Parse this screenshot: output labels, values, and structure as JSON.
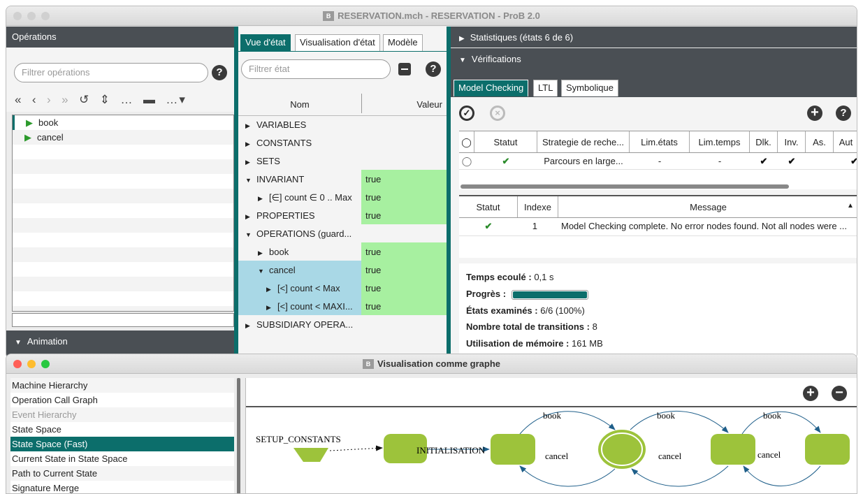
{
  "main_window": {
    "title": "RESERVATION.mch - RESERVATION - ProB 2.0"
  },
  "operations": {
    "header": "Opérations",
    "filter_placeholder": "Filtrer opérations",
    "toolbar": [
      "«",
      "‹",
      "›",
      "»",
      "↺",
      "⇕",
      "…",
      "…"
    ],
    "items": [
      "book",
      "cancel"
    ],
    "animation_label": "Animation"
  },
  "state_view": {
    "tabs": [
      "Vue d'état",
      "Visualisation d'état",
      "Modèle"
    ],
    "filter_placeholder": "Filtrer état",
    "col_name": "Nom",
    "col_value": "Valeur",
    "rows": [
      {
        "name": "VARIABLES",
        "value": "",
        "tri": "▶"
      },
      {
        "name": "CONSTANTS",
        "value": "",
        "tri": "▶"
      },
      {
        "name": "SETS",
        "value": "",
        "tri": "▶"
      },
      {
        "name": "INVARIANT",
        "value": "true",
        "tri": "▼"
      },
      {
        "name": "[∈] count ∈ 0 .. Max",
        "value": "true",
        "tri": "▶"
      },
      {
        "name": "PROPERTIES",
        "value": "true",
        "tri": "▶"
      },
      {
        "name": "OPERATIONS (guard...",
        "value": "",
        "tri": "▼"
      },
      {
        "name": "book",
        "value": "true",
        "tri": "▶"
      },
      {
        "name": "cancel",
        "value": "true",
        "tri": "▼"
      },
      {
        "name": "[<] count < Max",
        "value": "true",
        "tri": "▶"
      },
      {
        "name": "[<] count < MAXI...",
        "value": "true",
        "tri": "▶"
      },
      {
        "name": "SUBSIDIARY OPERA...",
        "value": "",
        "tri": "▶"
      }
    ]
  },
  "right_panel": {
    "stats_header": "Statistiques (états 6 de 6)",
    "verif_header": "Vérifications",
    "tabs": [
      "Model Checking",
      "LTL",
      "Symbolique"
    ],
    "table1_headers": [
      "Statut",
      "Strategie de reche...",
      "Lim.états",
      "Lim.temps",
      "Dlk.",
      "Inv.",
      "As.",
      "Aut"
    ],
    "table1_row": {
      "strategy": "Parcours en large...",
      "lim_states": "-",
      "lim_time": "-"
    },
    "table2_headers": [
      "Statut",
      "Indexe",
      "Message"
    ],
    "table2_row": {
      "index": "1",
      "message": "Model Checking complete. No error nodes found. Not all nodes were ..."
    },
    "stats": [
      {
        "label": "Temps ecoulé :",
        "value": "0,1 s"
      },
      {
        "label": "Progrès :",
        "value": ""
      },
      {
        "label": "États examinés :",
        "value": "6/6 (100%)"
      },
      {
        "label": "Nombre total de transitions :",
        "value": "8"
      },
      {
        "label": "Utilisation de mémoire :",
        "value": "161 MB"
      }
    ],
    "progress": 1.0
  },
  "graph_window": {
    "title": "Visualisation comme graphe",
    "list": [
      "Machine Hierarchy",
      "Operation Call Graph",
      "Event Hierarchy",
      "State Space",
      "State Space (Fast)",
      "Current State in State Space",
      "Path to Current State",
      "Signature Merge"
    ],
    "selected": "State Space (Fast)",
    "graph_labels": {
      "setup": "SETUP_CONSTANTS",
      "init": "INITIALISATION",
      "book": "book",
      "cancel": "cancel"
    }
  },
  "colors": {
    "accent": "#0c6e6b",
    "green_state": "#9dc33b",
    "true_bg": "#a7f0a0",
    "selected_bg": "#a9d8e6",
    "dark_header": "#4a4f54"
  }
}
